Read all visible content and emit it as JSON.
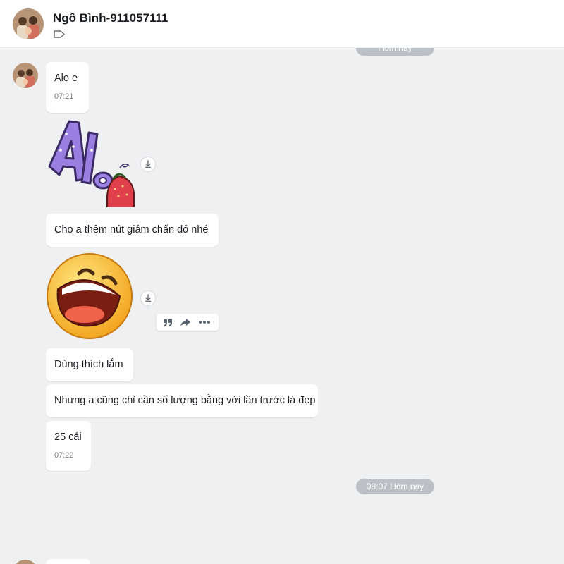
{
  "header": {
    "contact_name": "Ngô Bình-911057111"
  },
  "chat": {
    "date_separator_top": "Hôm nay",
    "date_separator_mid": "08:07 Hôm nay",
    "messages": [
      {
        "text": "Alo e",
        "time": "07:21"
      },
      {
        "text": "Cho a thêm nút giảm chấn đó nhé"
      },
      {
        "text": "Dùng thích lắm"
      },
      {
        "text": "Nhưng a cũng chỉ cần số lượng bằng với lần trước là đẹp"
      },
      {
        "text": "25 cái",
        "time": "07:22"
      }
    ]
  },
  "icons": {
    "tag": "tag-icon",
    "download": "download-icon",
    "quote": "quote-icon",
    "share": "share-icon",
    "more": "more-icon"
  },
  "colors": {
    "background": "#eef0f1",
    "bubble": "#ffffff",
    "time_pill": "#bcc1c7"
  }
}
